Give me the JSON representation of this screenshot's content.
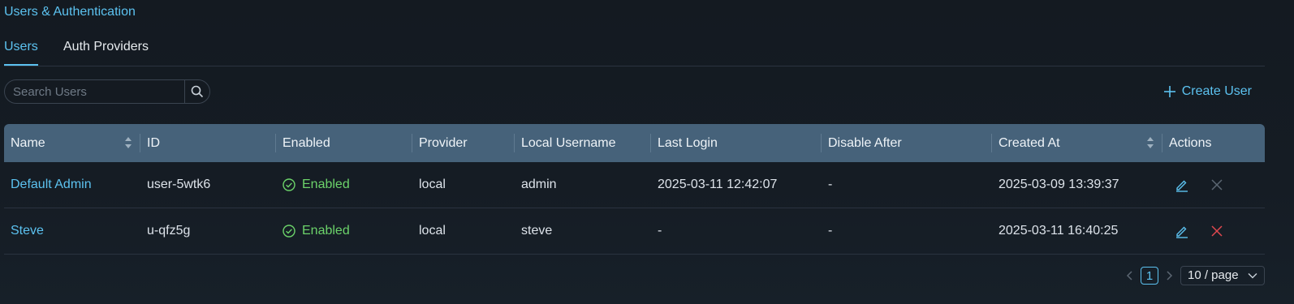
{
  "page": {
    "title": "Users & Authentication"
  },
  "tabs": [
    {
      "label": "Users",
      "active": true
    },
    {
      "label": "Auth Providers",
      "active": false
    }
  ],
  "search": {
    "placeholder": "Search Users",
    "value": ""
  },
  "toolbar": {
    "create_label": "Create User"
  },
  "table": {
    "columns": [
      "Name",
      "ID",
      "Enabled",
      "Provider",
      "Local Username",
      "Last Login",
      "Disable After",
      "Created At",
      "Actions"
    ],
    "rows": [
      {
        "name": "Default Admin",
        "id": "user-5wtk6",
        "enabled": "Enabled",
        "provider": "local",
        "local_username": "admin",
        "last_login": "2025-03-11 12:42:07",
        "disable_after": "-",
        "created_at": "2025-03-09 13:39:37"
      },
      {
        "name": "Steve",
        "id": "u-qfz5g",
        "enabled": "Enabled",
        "provider": "local",
        "local_username": "steve",
        "last_login": "-",
        "disable_after": "-",
        "created_at": "2025-03-11 16:40:25"
      }
    ]
  },
  "pagination": {
    "current_page": "1",
    "page_size": "10 / page"
  },
  "colors": {
    "accent": "#5cc2f0",
    "enabled": "#6cd36a",
    "danger": "#e0484f",
    "header_bg": "#46627a"
  }
}
